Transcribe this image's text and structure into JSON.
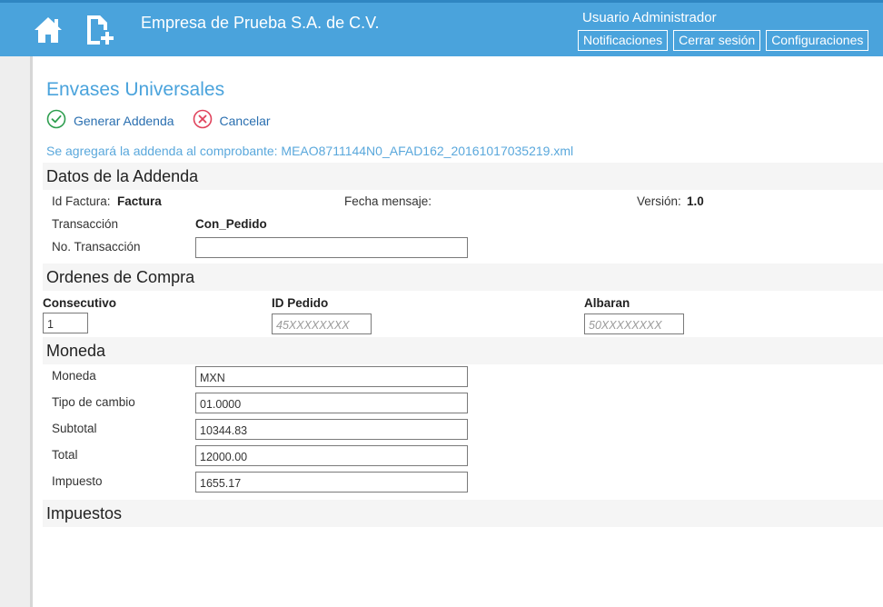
{
  "header": {
    "company": "Empresa de Prueba S.A. de C.V.",
    "user": "Usuario Administrador",
    "links": [
      "Notificaciones",
      "Cerrar sesión",
      "Configuraciones"
    ]
  },
  "page": {
    "title": "Envases Universales",
    "generate_label": "Generar Addenda",
    "cancel_label": "Cancelar",
    "notice": "Se agregará la addenda al comprobante: MEAO8711144N0_AFAD162_20161017035219.xml"
  },
  "datos": {
    "section_title": "Datos de la Addenda",
    "id_factura_label": "Id Factura:",
    "id_factura_value": "Factura",
    "fecha_label": "Fecha mensaje:",
    "version_label": "Versión:",
    "version_value": "1.0",
    "transaccion_label": "Transacción",
    "transaccion_value": "Con_Pedido",
    "no_transaccion_label": "No. Transacción",
    "no_transaccion_value": ""
  },
  "ordenes": {
    "section_title": "Ordenes de Compra",
    "consecutivo_header": "Consecutivo",
    "consecutivo_value": "1",
    "id_pedido_header": "ID Pedido",
    "id_pedido_placeholder": "45XXXXXXXX",
    "albaran_header": "Albaran",
    "albaran_placeholder": "50XXXXXXXX"
  },
  "moneda": {
    "section_title": "Moneda",
    "fields": [
      {
        "label": "Moneda",
        "value": "MXN"
      },
      {
        "label": "Tipo de cambio",
        "value": "01.0000"
      },
      {
        "label": "Subtotal",
        "value": "10344.83"
      },
      {
        "label": "Total",
        "value": "12000.00"
      },
      {
        "label": "Impuesto",
        "value": "1655.17"
      }
    ]
  },
  "impuestos": {
    "section_title": "Impuestos"
  },
  "colors": {
    "header_bg": "#4aa3dc",
    "title": "#4aa3dc",
    "link": "#2a6fb0",
    "ok_icon": "#2e9e4f",
    "cancel_icon": "#e0435c"
  }
}
